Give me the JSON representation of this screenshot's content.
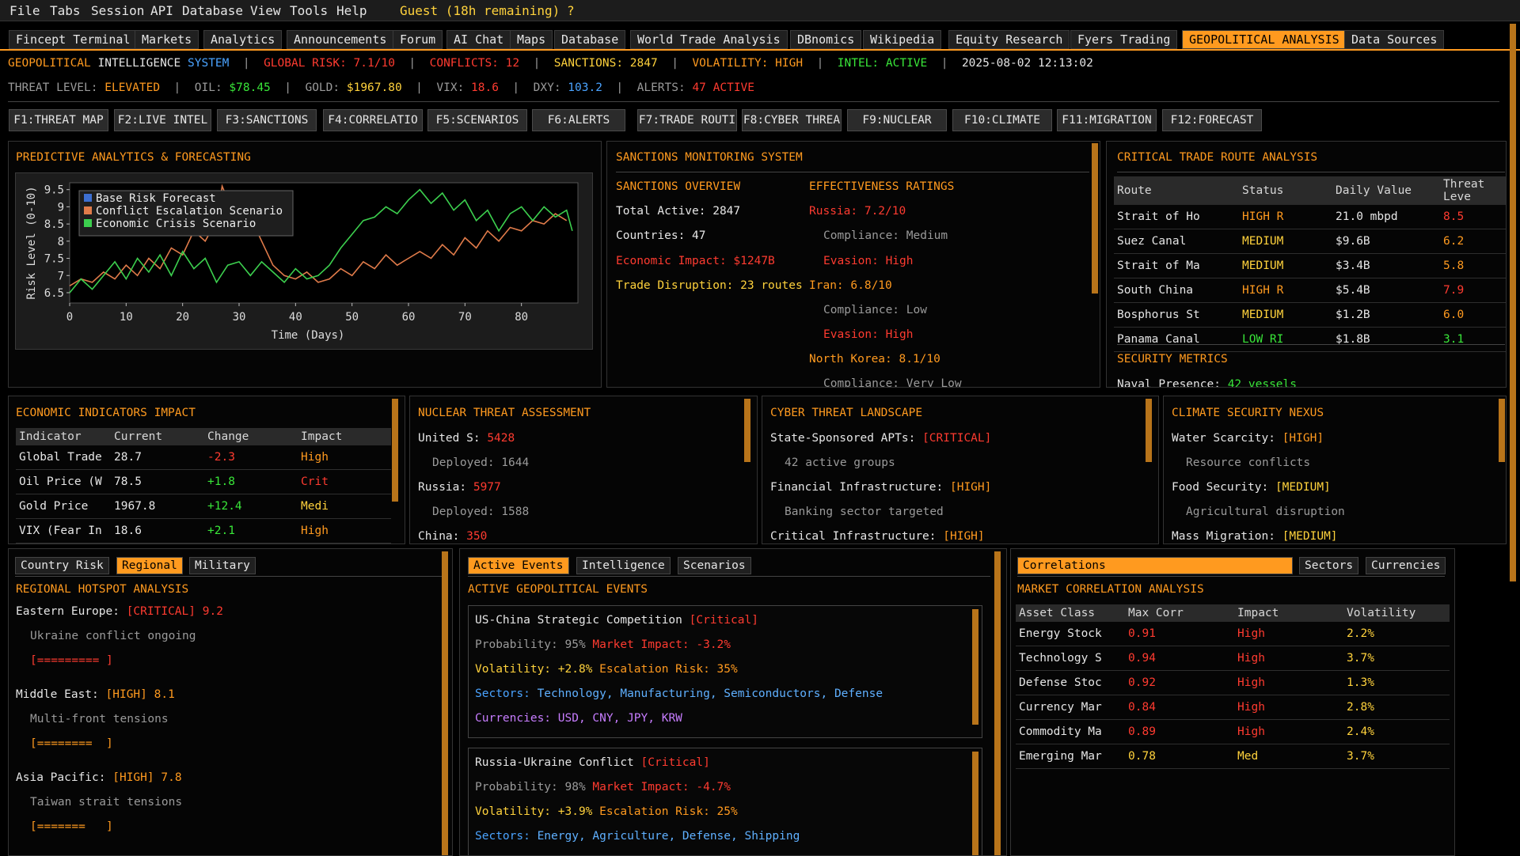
{
  "menu": [
    "File",
    "Tabs",
    "Session",
    "API",
    "Database",
    "View",
    "Tools",
    "Help"
  ],
  "guest": "Guest (18h remaining)",
  "help_mark": "?",
  "tabs": [
    "Fincept Terminal",
    "Markets",
    "Analytics",
    "Announcements",
    "Forum",
    "AI Chat",
    "Maps",
    "Database",
    "World Trade Analysis",
    "DBnomics",
    "Wikipedia",
    "Equity Research",
    "Fyers Trading",
    "GEOPOLITICAL ANALYSIS",
    "Data Sources"
  ],
  "status1": {
    "geo": "GEOPOLITICAL",
    "intel": "INTELLIGENCE",
    "system": "SYSTEM",
    "risk": "GLOBAL RISK: 7.1/10",
    "conflicts": "CONFLICTS: 12",
    "sanctions": "SANCTIONS: 2847",
    "volatility": "VOLATILITY: HIGH",
    "intel_status": "INTEL: ACTIVE",
    "datetime": "2025-08-02 12:13:02",
    "sep": "|"
  },
  "status2": {
    "threat_label": "THREAT LEVEL:",
    "threat_val": "ELEVATED",
    "oil_label": "OIL:",
    "oil_val": "$78.45",
    "gold_label": "GOLD:",
    "gold_val": "$1967.80",
    "vix_label": "VIX:",
    "vix_val": "18.6",
    "dxy_label": "DXY:",
    "dxy_val": "103.2",
    "alerts_label": "ALERTS:",
    "alerts_val": "47 ACTIVE"
  },
  "fkeys": [
    "F1:THREAT MAP",
    "F2:LIVE INTEL",
    "F3:SANCTIONS",
    "F4:CORRELATIO",
    "F5:SCENARIOS",
    "F6:ALERTS",
    "F7:TRADE ROUTI",
    "F8:CYBER THREA",
    "F9:NUCLEAR",
    "F10:CLIMATE",
    "F11:MIGRATION",
    "F12:FORECAST"
  ],
  "forecast": {
    "title": "PREDICTIVE ANALYTICS & FORECASTING"
  },
  "chart_data": {
    "type": "line",
    "title": "",
    "xlabel": "Time (Days)",
    "ylabel": "Risk Level (0-10)",
    "xlim": [
      0,
      90
    ],
    "ylim": [
      6.2,
      9.7
    ],
    "xticks": [
      "0",
      "10",
      "20",
      "30",
      "40",
      "50",
      "60",
      "70",
      "80"
    ],
    "yticks": [
      "6.5",
      "7",
      "7.5",
      "8",
      "8.5",
      "9",
      "9.5"
    ],
    "legend_position": "top-left",
    "grid": false,
    "series": [
      {
        "name": "Base Risk Forecast",
        "color": "#3d6fd1",
        "x": [],
        "y": []
      },
      {
        "name": "Conflict Escalation Scenario",
        "color": "#e07b4a",
        "x": [
          0,
          2,
          4,
          6,
          8,
          10,
          12,
          14,
          16,
          18,
          20,
          22,
          24,
          26,
          27,
          28,
          30,
          32,
          34,
          36,
          38,
          40,
          42,
          44,
          46,
          48,
          50,
          52,
          54,
          56,
          58,
          60,
          62,
          64,
          66,
          68,
          70,
          72,
          74,
          76,
          78,
          80,
          82,
          84,
          86,
          88
        ],
        "y": [
          6.7,
          6.9,
          6.8,
          7.1,
          6.9,
          7.3,
          7.0,
          7.5,
          7.2,
          7.8,
          7.6,
          8.3,
          8.0,
          8.6,
          9.6,
          9.2,
          9.4,
          8.7,
          8.0,
          7.3,
          7.0,
          6.9,
          7.1,
          6.8,
          6.9,
          7.2,
          7.0,
          7.4,
          7.2,
          7.6,
          7.3,
          7.5,
          7.7,
          7.5,
          7.9,
          7.6,
          8.1,
          7.8,
          8.3,
          8.0,
          8.4,
          8.3,
          8.6,
          8.5,
          8.8,
          8.6
        ]
      },
      {
        "name": "Economic Crisis Scenario",
        "color": "#3ccf4e",
        "x": [
          0,
          2,
          4,
          6,
          8,
          10,
          12,
          14,
          16,
          18,
          20,
          22,
          24,
          26,
          28,
          30,
          32,
          34,
          36,
          38,
          40,
          42,
          44,
          46,
          48,
          50,
          52,
          54,
          56,
          58,
          60,
          62,
          64,
          66,
          68,
          70,
          72,
          74,
          76,
          78,
          80,
          82,
          84,
          86,
          88,
          89
        ],
        "y": [
          6.5,
          6.9,
          6.6,
          7.0,
          7.4,
          6.9,
          7.5,
          7.1,
          7.6,
          7.0,
          7.7,
          7.2,
          7.5,
          6.8,
          7.3,
          7.4,
          7.0,
          7.4,
          7.1,
          6.8,
          7.2,
          6.9,
          7.0,
          7.3,
          7.8,
          8.2,
          8.6,
          8.7,
          9.0,
          8.8,
          9.2,
          9.5,
          9.1,
          9.4,
          8.9,
          9.2,
          8.6,
          8.9,
          8.3,
          8.8,
          9.0,
          8.6,
          9.0,
          8.7,
          8.9,
          8.3
        ]
      }
    ]
  },
  "sanctions": {
    "title": "SANCTIONS MONITORING SYSTEM",
    "overview_title": "SANCTIONS OVERVIEW",
    "total": "Total Active: 2847",
    "countries": "Countries: 47",
    "impact": "Economic Impact: $1247B",
    "disruption": "Trade Disruption: 23 routes",
    "eff_title": "EFFECTIVENESS RATINGS",
    "russia": "Russia: 7.2/10",
    "russia_comp": "Compliance: Medium",
    "russia_ev": "Evasion: High",
    "iran": "Iran: 6.8/10",
    "iran_comp": "Compliance: Low",
    "iran_ev": "Evasion: High",
    "nk": "North Korea: 8.1/10",
    "nk_comp": "Compliance: Very Low"
  },
  "trade_routes": {
    "title": "CRITICAL TRADE ROUTE ANALYSIS",
    "headers": [
      "Route",
      "Status",
      "Daily Value",
      "Threat Leve"
    ],
    "rows": [
      {
        "route": "Strait of Ho",
        "status": "HIGH R",
        "value": "21.0 mbpd",
        "threat": "8.5",
        "sc": "#ff9a1f",
        "tc": "#ff3b30"
      },
      {
        "route": "Suez Canal",
        "status": "MEDIUM",
        "value": "$9.6B",
        "threat": "6.2",
        "sc": "#ffd23c",
        "tc": "#ff9a1f"
      },
      {
        "route": "Strait of Ma",
        "status": "MEDIUM",
        "value": "$3.4B",
        "threat": "5.8",
        "sc": "#ffd23c",
        "tc": "#ff9a1f"
      },
      {
        "route": "South China",
        "status": "HIGH R",
        "value": "$5.4B",
        "threat": "7.9",
        "sc": "#ff9a1f",
        "tc": "#ff3b30"
      },
      {
        "route": "Bosphorus St",
        "status": "MEDIUM",
        "value": "$1.2B",
        "threat": "6.0",
        "sc": "#ffd23c",
        "tc": "#ff9a1f"
      },
      {
        "route": "Panama Canal",
        "status": "LOW RI",
        "value": "$1.8B",
        "threat": "3.1",
        "sc": "#39e639",
        "tc": "#39e639"
      }
    ],
    "security_title": "SECURITY METRICS",
    "naval_label": "Naval Presence:",
    "naval_val": "42 vessels"
  },
  "econ": {
    "title": "ECONOMIC INDICATORS IMPACT",
    "headers": [
      "Indicator",
      "Current",
      "Change",
      "Impact"
    ],
    "rows": [
      {
        "name": "Global Trade",
        "current": "28.7",
        "change": "-2.3",
        "impact": "High",
        "cc": "#ff3b30",
        "ic": "#ff9a1f"
      },
      {
        "name": "Oil Price (W",
        "current": "78.5",
        "change": "+1.8",
        "impact": "Crit",
        "cc": "#39e639",
        "ic": "#ff3b30"
      },
      {
        "name": "Gold Price",
        "current": "1967.8",
        "change": "+12.4",
        "impact": "Medi",
        "cc": "#39e639",
        "ic": "#ffd23c"
      },
      {
        "name": "VIX (Fear In",
        "current": "18.6",
        "change": "+2.1",
        "impact": "High",
        "cc": "#39e639",
        "ic": "#ff9a1f"
      }
    ]
  },
  "nuclear": {
    "title": "NUCLEAR THREAT ASSESSMENT",
    "us_label": "United S:",
    "us_val": "5428",
    "us_dep": "Deployed: 1644",
    "ru_label": "Russia:",
    "ru_val": "5977",
    "ru_dep": "Deployed: 1588",
    "cn_label": "China:",
    "cn_val": "350"
  },
  "cyber": {
    "title": "CYBER THREAT LANDSCAPE",
    "l1": "State-Sponsored APTs:",
    "l1v": "[CRITICAL]",
    "l1s": "42 active groups",
    "l2": "Financial Infrastructure:",
    "l2v": "[HIGH]",
    "l2s": "Banking sector targeted",
    "l3": "Critical Infrastructure:",
    "l3v": "[HIGH]"
  },
  "climate": {
    "title": "CLIMATE SECURITY NEXUS",
    "l1": "Water Scarcity:",
    "l1v": "[HIGH]",
    "l1s": "Resource conflicts",
    "l2": "Food Security:",
    "l2v": "[MEDIUM]",
    "l2s": "Agricultural disruption",
    "l3": "Mass Migration:",
    "l3v": "[MEDIUM]"
  },
  "regional": {
    "tabs": [
      "Country Risk",
      "Regional",
      "Military"
    ],
    "title": "REGIONAL HOTSPOT ANALYSIS",
    "items": [
      {
        "name": "Eastern Europe:",
        "level": "[CRITICAL]",
        "score": "9.2",
        "note": "Ukraine conflict ongoing",
        "bar": "[========= ]",
        "color": "#ff3b30"
      },
      {
        "name": "Middle East:",
        "level": "[HIGH]",
        "score": "8.1",
        "note": "Multi-front tensions",
        "bar": "[========  ]",
        "color": "#ff9a1f"
      },
      {
        "name": "Asia Pacific:",
        "level": "[HIGH]",
        "score": "7.8",
        "note": "Taiwan strait tensions",
        "bar": "[=======   ]",
        "color": "#ff9a1f"
      }
    ]
  },
  "events": {
    "tabs": [
      "Active Events",
      "Intelligence",
      "Scenarios"
    ],
    "title": "ACTIVE GEOPOLITICAL EVENTS",
    "items": [
      {
        "name": "US-China Strategic Competition",
        "level": "[Critical]",
        "prob": "Probability: 95%",
        "impact": "Market Impact: -3.2%",
        "vol": "Volatility: +2.8%",
        "esc": "Escalation Risk: 35%",
        "sectors_label": "Sectors:",
        "sectors": "Technology, Manufacturing, Semiconductors, Defense",
        "curr_label": "Currencies:",
        "curr": "USD, CNY, JPY, KRW"
      },
      {
        "name": "Russia-Ukraine Conflict",
        "level": "[Critical]",
        "prob": "Probability: 98%",
        "impact": "Market Impact: -4.7%",
        "vol": "Volatility: +3.9%",
        "esc": "Escalation Risk: 25%",
        "sectors_label": "Sectors:",
        "sectors": "Energy, Agriculture, Defense, Shipping"
      }
    ]
  },
  "correlations": {
    "tabs": [
      "Correlations",
      "Sectors",
      "Currencies"
    ],
    "title": "MARKET CORRELATION ANALYSIS",
    "headers": [
      "Asset Class",
      "Max Corr",
      "Impact",
      "Volatility"
    ],
    "rows": [
      {
        "asset": "Energy Stock",
        "corr": "0.91",
        "impact": "High",
        "vol": "2.2%",
        "cc": "#ff3b30",
        "ic": "#ff3b30"
      },
      {
        "asset": "Technology S",
        "corr": "0.94",
        "impact": "High",
        "vol": "3.7%",
        "cc": "#ff3b30",
        "ic": "#ff3b30"
      },
      {
        "asset": "Defense Stoc",
        "corr": "0.92",
        "impact": "High",
        "vol": "1.3%",
        "cc": "#ff3b30",
        "ic": "#ff3b30"
      },
      {
        "asset": "Currency Mar",
        "corr": "0.84",
        "impact": "High",
        "vol": "2.8%",
        "cc": "#ff3b30",
        "ic": "#ff3b30"
      },
      {
        "asset": "Commodity Ma",
        "corr": "0.89",
        "impact": "High",
        "vol": "2.4%",
        "cc": "#ff3b30",
        "ic": "#ff3b30"
      },
      {
        "asset": "Emerging Mar",
        "corr": "0.78",
        "impact": "Med",
        "vol": "3.7%",
        "cc": "#ffd23c",
        "ic": "#ffd23c"
      }
    ]
  }
}
